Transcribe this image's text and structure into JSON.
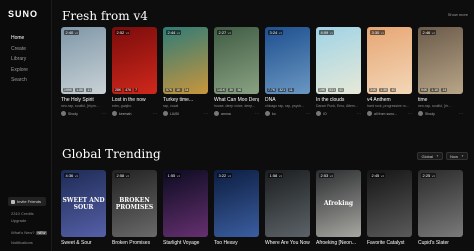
{
  "brand": "SUNO",
  "sidebar": {
    "items": [
      {
        "label": "Home",
        "active": true
      },
      {
        "label": "Create",
        "active": false
      },
      {
        "label": "Library",
        "active": false
      },
      {
        "label": "Explore",
        "active": false
      },
      {
        "label": "Search",
        "active": false
      }
    ],
    "invite_label": "Invite Friends",
    "credits": "2310 Credits",
    "upgrade": "Upgrade",
    "whats_new": "What's New?",
    "new_badge": "NEW",
    "notifications": "Notifications"
  },
  "sections": {
    "fresh": {
      "title": "Fresh from v4",
      "show_more": "Show more",
      "songs": [
        {
          "title": "The Holy Spirit",
          "tags": "neo-rap, soulful, [rhym...",
          "user": "Shody",
          "duration": "2:40",
          "tag": "v4",
          "plays": "199K",
          "likes": "1.8K",
          "comments": "11",
          "colors": [
            "#7f97a8",
            "#c9d2d6"
          ]
        },
        {
          "title": "Lost in the now",
          "tags": "edm, guajiro",
          "user": "keemah",
          "duration": "2:52",
          "tag": "v4",
          "plays": "28K",
          "likes": "476",
          "comments": "7",
          "colors": [
            "#7a0c0c",
            "#d0281b"
          ]
        },
        {
          "title": "Turkey time...",
          "tags": "rap, vocal",
          "user": "LIUBI",
          "duration": "2:44",
          "tag": "v4",
          "plays": "57K",
          "likes": "1K",
          "comments": "34",
          "colors": [
            "#2f7b78",
            "#c9963b"
          ]
        },
        {
          "title": "What Can Moo Deng...",
          "tags": "house, deep voice, deep...",
          "user": "annna",
          "duration": "2:27",
          "tag": "v4",
          "plays": "141K",
          "likes": "3K",
          "comments": "56",
          "colors": [
            "#3f5c43",
            "#8aa283"
          ]
        },
        {
          "title": "DNA",
          "tags": "chicago rap, rap, psych...",
          "user": "ko",
          "duration": "3:24",
          "tag": "v4",
          "plays": "7.7K",
          "likes": "321",
          "comments": "11",
          "colors": [
            "#1e4f8f",
            "#6a97c2"
          ]
        },
        {
          "title": "In the clouds",
          "tags": "Dance Punk, Emo, Altern...",
          "user": "IO",
          "duration": "4:09",
          "tag": "v4",
          "plays": "19K",
          "likes": "531",
          "comments": "41",
          "colors": [
            "#9fd3e6",
            "#e7e9d8"
          ]
        },
        {
          "title": "v4 Anthem",
          "tags": "hard rock, progressive ro...",
          "user": "all from suno...",
          "duration": "3:30",
          "tag": "v4",
          "plays": "34K",
          "likes": "1.3K",
          "comments": "40",
          "colors": [
            "#e7a673",
            "#f3d7b8"
          ]
        },
        {
          "title": "time",
          "tags": "neo-rap, soulful, [rh...",
          "user": "Shody",
          "duration": "2:46",
          "tag": "v4",
          "plays": "94K",
          "likes": "1.1K",
          "comments": "14",
          "colors": [
            "#6a5a49",
            "#b9a689"
          ]
        }
      ]
    },
    "global": {
      "title": "Global Trending",
      "filter_region": "Global",
      "filter_time": "Now",
      "songs": [
        {
          "title": "Sweet & Sour",
          "tags": "",
          "user": "",
          "duration": "4:36",
          "tag": "v4",
          "plays": "",
          "likes": "",
          "comments": "",
          "colors": [
            "#1d2b55",
            "#5660a8"
          ],
          "art_text": "SWEET AND SOUR"
        },
        {
          "title": "Broken Promises",
          "tags": "",
          "user": "",
          "duration": "2:58",
          "tag": "v4",
          "plays": "",
          "likes": "",
          "comments": "",
          "colors": [
            "#222",
            "#6a6a6a"
          ],
          "art_text": "BROKEN PROMISES"
        },
        {
          "title": "Starlight Voyage",
          "tags": "",
          "user": "",
          "duration": "1:55",
          "tag": "v4",
          "plays": "",
          "likes": "",
          "comments": "",
          "colors": [
            "#0b0b20",
            "#663070"
          ],
          "art_text": ""
        },
        {
          "title": "Too Heavy",
          "tags": "",
          "user": "",
          "duration": "3:22",
          "tag": "v4",
          "plays": "",
          "likes": "",
          "comments": "",
          "colors": [
            "#0c1d40",
            "#3b5ea0"
          ],
          "art_text": ""
        },
        {
          "title": "Where Are You Now?",
          "tags": "",
          "user": "",
          "duration": "1:58",
          "tag": "v4",
          "plays": "",
          "likes": "",
          "comments": "",
          "colors": [
            "#1b1e20",
            "#5c6368"
          ],
          "art_text": ""
        },
        {
          "title": "Afroeking [Neon...",
          "tags": "",
          "user": "",
          "duration": "2:53",
          "tag": "v4",
          "plays": "",
          "likes": "",
          "comments": "",
          "colors": [
            "#2b2d2f",
            "#a7a7a2"
          ],
          "art_text": "Afroking"
        },
        {
          "title": "Favorite Catalyst",
          "tags": "",
          "user": "",
          "duration": "2:45",
          "tag": "v4",
          "plays": "",
          "likes": "",
          "comments": "",
          "colors": [
            "#151515",
            "#5a5a5a"
          ],
          "art_text": ""
        },
        {
          "title": "Cupid's Slater",
          "tags": "",
          "user": "",
          "duration": "2:25",
          "tag": "v4",
          "plays": "",
          "likes": "",
          "comments": "",
          "colors": [
            "#2a2a2a",
            "#7a7a7a"
          ],
          "art_text": ""
        }
      ]
    }
  }
}
